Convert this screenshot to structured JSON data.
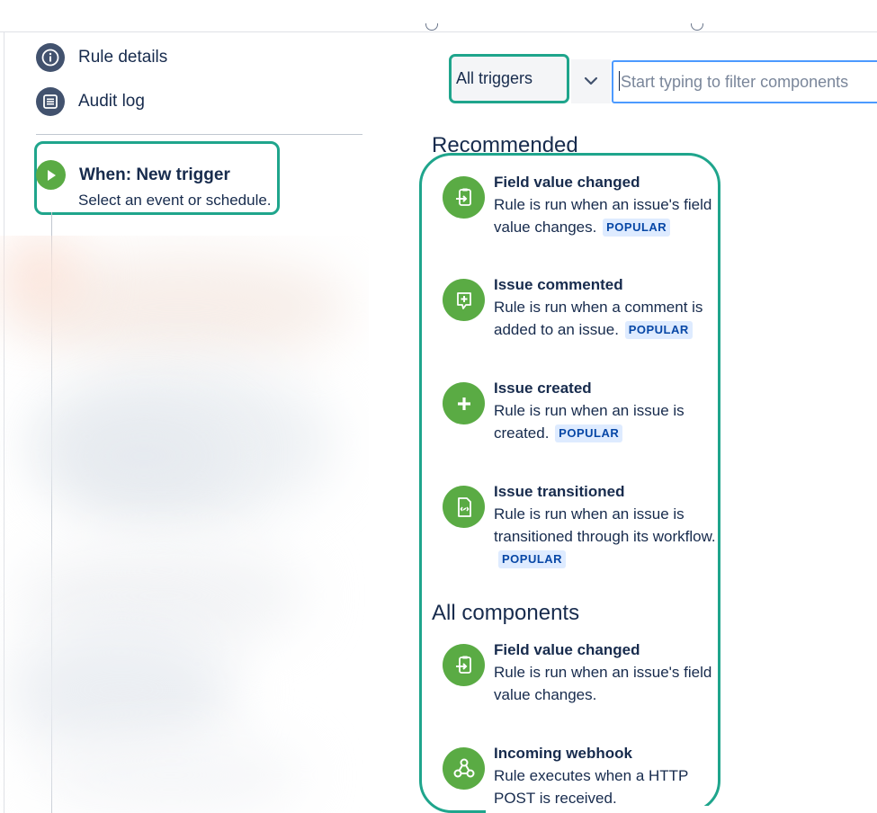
{
  "sidebar": {
    "items": [
      {
        "label": "Rule details",
        "icon": "info-icon"
      },
      {
        "label": "Audit log",
        "icon": "list-icon"
      }
    ],
    "trigger": {
      "title": "When: New trigger",
      "subtitle": "Select an event or schedule.",
      "icon": "play-icon"
    }
  },
  "filter": {
    "select_value": "All triggers",
    "input_placeholder": "Start typing to filter components"
  },
  "sections": {
    "recommended_title": "Recommended",
    "all_title": "All components"
  },
  "recommended": [
    {
      "title": "Field value changed",
      "description": "Rule is run when an issue's field value changes.",
      "badge": "POPULAR",
      "icon": "field-change-icon"
    },
    {
      "title": "Issue commented",
      "description": "Rule is run when a comment is added to an issue.",
      "badge": "POPULAR",
      "icon": "comment-plus-icon"
    },
    {
      "title": "Issue created",
      "description": "Rule is run when an issue is created.",
      "badge": "POPULAR",
      "icon": "plus-icon"
    },
    {
      "title": "Issue transitioned",
      "description": "Rule is run when an issue is transitioned through its workflow.",
      "badge": "POPULAR",
      "icon": "document-transition-icon"
    }
  ],
  "all_components": [
    {
      "title": "Field value changed",
      "description": "Rule is run when an issue's field value changes.",
      "icon": "field-change-icon"
    },
    {
      "title": "Incoming webhook",
      "description": "Rule executes when a HTTP POST is received.",
      "icon": "webhook-icon"
    }
  ],
  "colors": {
    "highlight": "#1fa58c",
    "trigger_green": "#5aab44",
    "nav_icon": "#42526e",
    "badge_bg": "#deebff",
    "badge_text": "#0747a6",
    "input_focus": "#4c9aff"
  }
}
